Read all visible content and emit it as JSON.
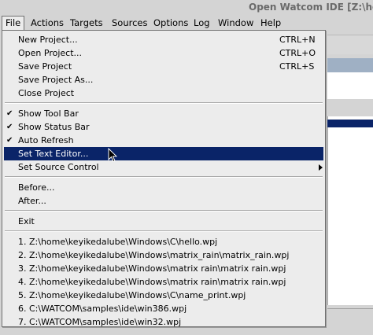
{
  "window": {
    "title": "Open Watcom IDE [Z:\\hom"
  },
  "menubar": {
    "items": [
      {
        "key": "file",
        "label": "File"
      },
      {
        "key": "actions",
        "label": "Actions"
      },
      {
        "key": "targets",
        "label": "Targets"
      },
      {
        "key": "sources",
        "label": "Sources"
      },
      {
        "key": "options",
        "label": "Options"
      },
      {
        "key": "log",
        "label": "Log"
      },
      {
        "key": "window",
        "label": "Window"
      },
      {
        "key": "help",
        "label": "Help"
      }
    ]
  },
  "file_menu": {
    "new_project": {
      "label": "New Project...",
      "shortcut": "CTRL+N"
    },
    "open_project": {
      "label": "Open Project...",
      "shortcut": "CTRL+O"
    },
    "save_project": {
      "label": "Save Project",
      "shortcut": "CTRL+S"
    },
    "save_project_as": {
      "label": "Save Project As..."
    },
    "close_project": {
      "label": "Close Project"
    },
    "show_tool_bar": {
      "label": "Show Tool Bar",
      "checked": true
    },
    "show_status_bar": {
      "label": "Show Status Bar",
      "checked": true
    },
    "auto_refresh": {
      "label": "Auto Refresh",
      "checked": true
    },
    "set_text_editor": {
      "label": "Set Text Editor...",
      "highlighted": true
    },
    "set_source_control": {
      "label": "Set Source Control",
      "has_submenu": true
    },
    "before": {
      "label": "Before..."
    },
    "after": {
      "label": "After..."
    },
    "exit": {
      "label": "Exit"
    },
    "recent": [
      {
        "label": "1. Z:\\home\\keyikedalube\\Windows\\C\\hello.wpj"
      },
      {
        "label": "2. Z:\\home\\keyikedalube\\Windows\\matrix_rain\\matrix_rain.wpj"
      },
      {
        "label": "3. Z:\\home\\keyikedalube\\Windows\\matrix rain\\matrix rain.wpj"
      },
      {
        "label": "4. Z:\\home\\keyikedalube\\Windows\\matrix rain\\matrix rain.wpj"
      },
      {
        "label": "5. Z:\\home\\keyikedalube\\Windows\\C\\name_print.wpj"
      },
      {
        "label": "6. C:\\WATCOM\\samples\\ide\\win386.wpj"
      },
      {
        "label": "7. C:\\WATCOM\\samples\\ide\\win32.wpj"
      }
    ]
  },
  "icons": {
    "check": "checkmark-icon",
    "submenu": "submenu-arrow-icon",
    "cursor": "mouse-pointer-icon"
  },
  "colors": {
    "selection": "#0a2468",
    "menu_bg": "#ececec",
    "window_bg": "#d4d4d4"
  }
}
